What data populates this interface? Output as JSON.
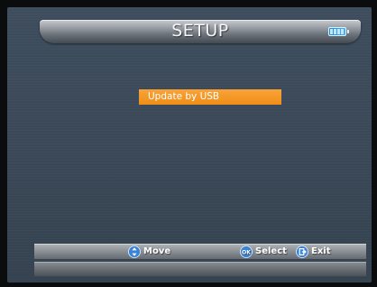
{
  "header": {
    "title": "SETUP",
    "battery_icon": "battery-icon"
  },
  "menu": {
    "items": [
      {
        "label": "Update by USB",
        "selected": true
      }
    ],
    "highlight_color": "#f29418"
  },
  "footer": {
    "hints": [
      {
        "icon": "updown-arrow-icon",
        "label": "Move"
      },
      {
        "icon": "ok-icon",
        "label": "Select"
      },
      {
        "icon": "exit-icon",
        "label": "Exit"
      }
    ]
  },
  "colors": {
    "background": "#3b4959",
    "accent": "#f29418",
    "battery": "#2f9ee6"
  }
}
